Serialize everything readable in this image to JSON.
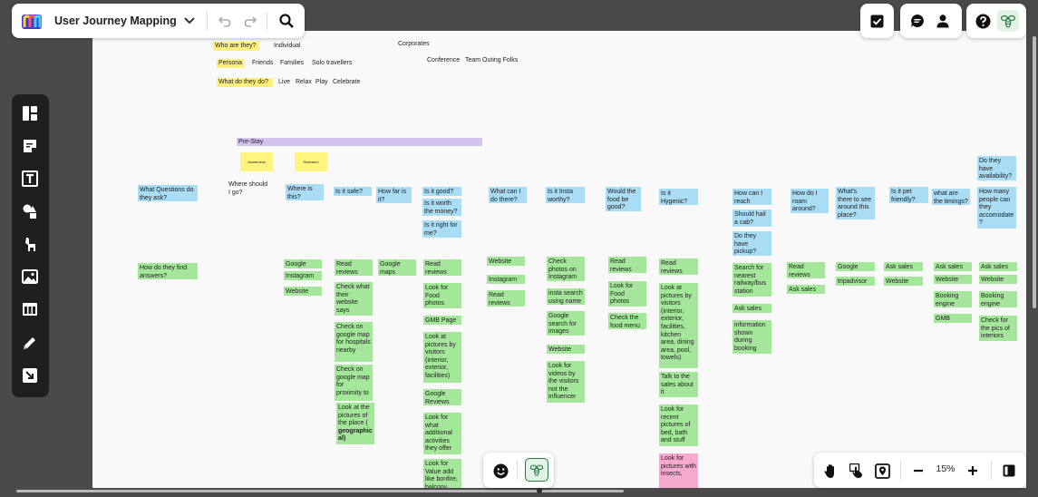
{
  "app": {
    "board_title": "User Journey Mapping"
  },
  "zoom": {
    "level": "15%"
  },
  "icons": {
    "logo": "miro-logo-icon",
    "undo": "undo-icon",
    "redo": "redo-icon",
    "search": "search-icon"
  },
  "header_row": {
    "who_label": "Who are they?",
    "who_1": "Individual",
    "who_2": "Corporates",
    "persona_label": "Persona",
    "persona_1": "Friends",
    "persona_2": "Families",
    "persona_3": "Solo travellers",
    "persona_4": "Conference",
    "persona_5": "Team Outing Folks",
    "what_label": "What do they do?",
    "what_1": "Live",
    "what_2": "Relax",
    "what_3": "Play",
    "what_4": "Celebrate"
  },
  "phase": {
    "name": "Pre-Stay",
    "sub_1": "Awareness",
    "sub_2": "Research"
  },
  "questions": {
    "q1": "What Questions do they ask?",
    "q2": "Where should I go?",
    "q3": "Where is this?",
    "q4": "Is it safe?",
    "q5": "How far is it?",
    "q6a": "Is it good?",
    "q6b": "Is it worth the money?",
    "q6c": "Is it right for me?",
    "q7": "What can I do there?",
    "q8": "Is it Insta worthy?",
    "q9": "Would the food be good?",
    "q10": "Is it Hygenic?",
    "q11a": "How can I reach there?",
    "q11b": "Should hail a cab?",
    "q11c": "Do they have pickup?",
    "q12": "How do I roam around?",
    "q13": "What's there to see around this place?",
    "q14": "Is it pet friendly?",
    "q15": "what are the timings?",
    "q16a": "Do they have availability?",
    "q16b": "How many people can they accomodate ?"
  },
  "answers": {
    "label": "How do they find answers?",
    "c3": [
      "Google",
      "Instagram",
      "Website"
    ],
    "c4": [
      "Read reviews",
      "Check what their website says",
      "Check on google map for hospitals nearby",
      "Check on google map for proximity to",
      "Look at the pictures of the place ( ",
      "geographic al)"
    ],
    "c5": [
      "Google maps"
    ],
    "c6": [
      "Read reviews",
      "Look for Food photos",
      "GMB Page",
      "Look at pictures by visitors (interior, exterior, facilities)",
      "Google Reviews",
      "Look for what additional activities they offer",
      "Look for Value add like bonfire, balcony"
    ],
    "c7": [
      "Website",
      "Instagram",
      "Read reviews"
    ],
    "c8": [
      "Check photos on Instagram",
      "insta search using name",
      "Google search for images",
      "Website",
      "Look for videos by the visitors not the influencer"
    ],
    "c9": [
      "Read reviews",
      "Look for Food photos",
      "Check the food menu"
    ],
    "c10": [
      "Read reviews",
      "Look at pictures by visitors (interior, exterior, facilities, kitchen area, dining area, pool, towels)",
      "Talk to the sales about it",
      "Look for recent pictures of bed, bath and stuff",
      "Look for pictures with insects,"
    ],
    "c11": [
      "Search for nearest railway/bus station",
      "Ask sales",
      "information shown during booking"
    ],
    "c12": [
      "Read reviews",
      "Ask sales"
    ],
    "c13": [
      "Google",
      "tripadvisor"
    ],
    "c14": [
      "Ask sales",
      "Website"
    ],
    "c15": [
      "Ask sales",
      "Website",
      "Booking engine",
      "GMB"
    ],
    "c16": [
      "Ask sales",
      "Website",
      "Booking engine",
      "Check for the pics of interiors"
    ]
  }
}
